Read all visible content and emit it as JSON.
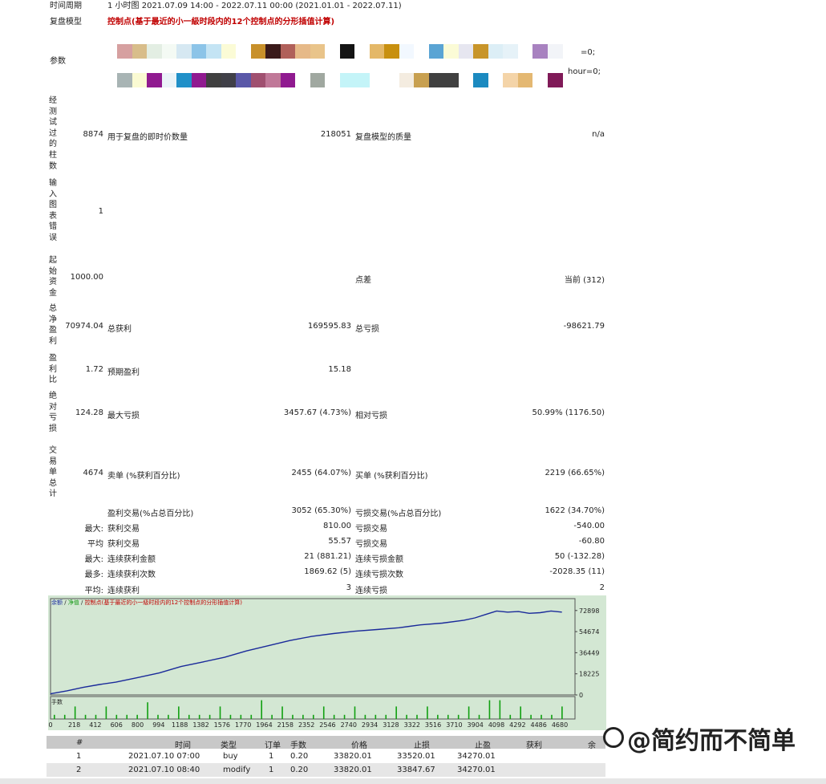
{
  "header": {
    "period_label": "时间周期",
    "period_value": "1 小时图 2021.07.09 14:00 - 2022.07.11 00:00 (2021.01.01 - 2022.07.11)",
    "model_label": "复盘模型",
    "model_value": "控制点(基于最近的小一級时段内的12个控制点的分形插值计算)",
    "params_label": "参数",
    "params_line1_tail": "=0;",
    "params_line2_tail": "hour=0;"
  },
  "swatches_row1": [
    "#d6a0a0",
    "#d8bd8a",
    "#e3eee3",
    "#f4faf4",
    "#d6e8f2",
    "#8cc4e8",
    "#c4e4f4",
    "#fbfbd6",
    "#ffffff",
    "#c8902a",
    "#3a1a1a",
    "#b0605a",
    "#e6b988",
    "#e9c48a",
    "#ffffff",
    "#141414",
    "#ffffff",
    "#e4b868",
    "#c8900f",
    "#f2f8ff",
    "#ffffff",
    "#5aa4d4",
    "#fbfbd6",
    "#e6e6f0",
    "#c8952a",
    "#dceef6",
    "#e6f2f8",
    "#ffffff",
    "#a882c0",
    "#f2f4f8"
  ],
  "swatches_row2": [
    "#a8b4b4",
    "#fafad2",
    "#901a90",
    "#eaf4f8",
    "#2090c8",
    "#901a90",
    "#404040",
    "#404048",
    "#5a58a8",
    "#a05070",
    "#c07898",
    "#901a90",
    "#ffffff",
    "#a0a8a0",
    "#ffffff",
    "#c4f4f8",
    "#c4f4f8",
    "#ffffff",
    "#ffffff",
    "#f4ece0",
    "#c8a050",
    "#404040",
    "#404040",
    "#ffffff",
    "#1b8ac0",
    "#ffffff",
    "#f4d4a8",
    "#e4b872",
    "#ffffff",
    "#801a58"
  ],
  "stats": {
    "bars_label": "经测试过的柱数",
    "bars_value": "8874",
    "ticks_label": "用于复盘的即时价数量",
    "ticks_value": "218051",
    "quality_label": "复盘模型的质量",
    "quality_value": "n/a",
    "errors_label": "输入图表错误",
    "errors_value": "1",
    "deposit_label": "起始资金",
    "deposit_value": "1000.00",
    "spread_label": "点差",
    "spread_value": "当前 (312)",
    "net_label": "总净盈利",
    "net_value": "70974.04",
    "gross_profit_label": "总获利",
    "gross_profit_value": "169595.83",
    "gross_loss_label": "总亏损",
    "gross_loss_value": "-98621.79",
    "pf_label": "盈利比",
    "pf_value": "1.72",
    "expected_label": "预期盈利",
    "expected_value": "15.18",
    "abs_dd_label": "绝对亏损",
    "abs_dd_value": "124.28",
    "max_dd_label": "最大亏损",
    "max_dd_value": "3457.67 (4.73%)",
    "rel_dd_label": "相对亏损",
    "rel_dd_value": "50.99% (1176.50)",
    "total_trades_label": "交易单总计",
    "total_trades_value": "4674",
    "short_label": "卖单 (%获利百分比)",
    "short_value": "2455 (64.07%)",
    "long_label": "买单 (%获利百分比)",
    "long_value": "2219 (66.65%)",
    "profit_trades_label": "盈利交易(%占总百分比)",
    "profit_trades_value": "3052 (65.30%)",
    "loss_trades_label": "亏损交易(%占总百分比)",
    "loss_trades_value": "1622 (34.70%)",
    "largest_prefix": "最大:",
    "largest_profit_label": "获利交易",
    "largest_profit_value": "810.00",
    "largest_loss_label": "亏损交易",
    "largest_loss_value": "-540.00",
    "average_prefix": "平均",
    "avg_profit_label": "获利交易",
    "avg_profit_value": "55.57",
    "avg_loss_label": "亏损交易",
    "avg_loss_value": "-60.80",
    "max_prefix": "最大:",
    "max_cons_wins_label": "连续获利金额",
    "max_cons_wins_value": "21 (881.21)",
    "max_cons_losses_label": "连续亏损金额",
    "max_cons_losses_value": "50 (-132.28)",
    "maximal_prefix": "最多:",
    "maximal_cons_profit_label": "连续获利次数",
    "maximal_cons_profit_value": "1869.62 (5)",
    "maximal_cons_loss_label": "连续亏损次数",
    "maximal_cons_loss_value": "-2028.35 (11)",
    "avg_cons_prefix": "平均:",
    "avg_cons_wins_label": "连续获利",
    "avg_cons_wins_value": "3",
    "avg_cons_losses_label": "连续亏损",
    "avg_cons_losses_value": "2"
  },
  "chart_legend": {
    "balance": "余额",
    "sep1": " / ",
    "equity": "净值",
    "sep2": " / ",
    "model": "控制点(基于最近的小一級时段内的12个控制点的分形插值计算)"
  },
  "volume_label": "手数",
  "chart_data": {
    "type": "line",
    "title": "",
    "xlabel": "",
    "ylabel": "",
    "x_ticks": [
      "0",
      "218",
      "412",
      "606",
      "800",
      "994",
      "1188",
      "1382",
      "1576",
      "1770",
      "1964",
      "2158",
      "2352",
      "2546",
      "2740",
      "2934",
      "3128",
      "3322",
      "3516",
      "3710",
      "3904",
      "4098",
      "4292",
      "4486",
      "4680"
    ],
    "y_ticks": [
      "72898",
      "54674",
      "36449",
      "18225",
      "0"
    ],
    "xlim": [
      0,
      4820
    ],
    "ylim": [
      0,
      79000
    ],
    "series": [
      {
        "values_x": [
          0,
          150,
          300,
          450,
          600,
          800,
          1000,
          1200,
          1400,
          1600,
          1800,
          2000,
          2200,
          2400,
          2600,
          2800,
          3000,
          3200,
          3400,
          3600,
          3800,
          3900,
          4000,
          4100,
          4200,
          4300,
          4400,
          4500,
          4600,
          4700
        ],
        "values_y": [
          1000,
          3500,
          6500,
          9000,
          11000,
          15000,
          19000,
          24500,
          28500,
          32500,
          38000,
          42500,
          47000,
          50500,
          53000,
          55000,
          56500,
          58000,
          60500,
          62000,
          64500,
          66500,
          69500,
          72500,
          71500,
          72000,
          70500,
          71000,
          72500,
          71500
        ]
      }
    ],
    "volume": [
      0.2,
      0.2,
      0.6,
      0.2,
      0.2,
      0.6,
      0.2,
      0.2,
      0.2,
      0.8,
      0.2,
      0.2,
      0.6,
      0.2,
      0.2,
      0.2,
      0.6,
      0.2,
      0.2,
      0.2,
      0.9,
      0.2,
      0.6,
      0.2,
      0.2,
      0.2,
      0.6,
      0.2,
      0.2,
      0.6,
      0.2,
      0.2,
      0.2,
      0.6,
      0.2,
      0.2,
      0.6,
      0.2,
      0.2,
      0.2,
      0.6,
      0.2,
      0.9,
      0.9,
      0.2,
      0.6,
      0.2,
      0.2,
      0.2,
      0.6
    ],
    "grid": false,
    "legend": "top-left"
  },
  "table": {
    "headers": [
      "#",
      "时间",
      "类型",
      "订单",
      "手数",
      "价格",
      "止损",
      "止盈",
      "获利",
      "余"
    ],
    "rows": [
      [
        "1",
        "2021.07.10 07:00",
        "buy",
        "1",
        "0.20",
        "33820.01",
        "33520.01",
        "34270.01",
        ""
      ],
      [
        "2",
        "2021.07.10 08:40",
        "modify",
        "1",
        "0.20",
        "33820.01",
        "33847.67",
        "34270.01",
        ""
      ]
    ]
  },
  "watermark": "@简约而不简单"
}
